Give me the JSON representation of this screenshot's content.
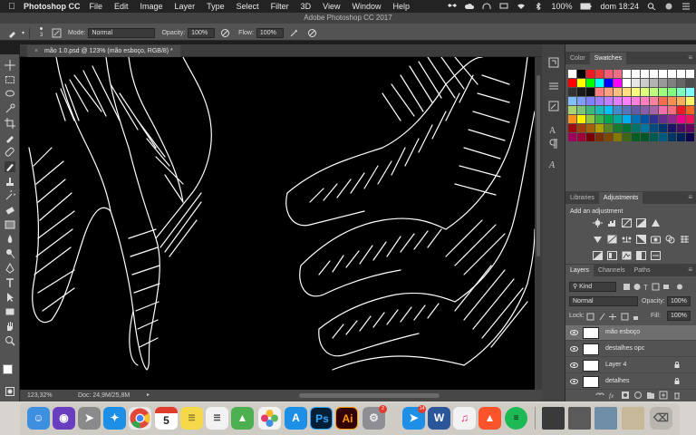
{
  "menubar": {
    "app_name": "Photoshop CC",
    "items": [
      "File",
      "Edit",
      "Image",
      "Layer",
      "Type",
      "Select",
      "Filter",
      "3D",
      "View",
      "Window",
      "Help"
    ],
    "battery": "100%",
    "clock": "dom 18:24"
  },
  "window": {
    "title": "Adobe Photoshop CC 2017"
  },
  "options": {
    "brush_size": "3",
    "mode_label": "Mode:",
    "mode_value": "Normal",
    "opacity_label": "Opacity:",
    "opacity_value": "100%",
    "flow_label": "Flow:",
    "flow_value": "100%"
  },
  "document": {
    "tab_label": "mão 1.0.psd @ 123% (mão esboço, RGB/8) *",
    "zoom": "123,32%",
    "doc_info": "Doc: 24,9M/25,8M"
  },
  "swatches_panel": {
    "tabs": [
      "Color",
      "Swatches"
    ],
    "active_tab": "Swatches",
    "colors": [
      "#ffffff",
      "#000000",
      "#ec1c24",
      "#ed3a3a",
      "#f45e7a",
      "#ed6e84",
      "#ffffff",
      "#ffffff",
      "#ffffff",
      "#ffffff",
      "#ffffff",
      "#ffffff",
      "#ffffff",
      "#ffffff",
      "#ff0000",
      "#ffff00",
      "#00ff00",
      "#00ffff",
      "#0000ff",
      "#ff00ff",
      "#ffffff",
      "#e6e6e6",
      "#cccccc",
      "#b3b3b3",
      "#999999",
      "#808080",
      "#666666",
      "#4d4d4d",
      "#333333",
      "#1a1a1a",
      "#0d0d0d",
      "#ff7f7f",
      "#ff9f7f",
      "#ffbf7f",
      "#ffdf7f",
      "#ffff7f",
      "#dfff7f",
      "#bfff7f",
      "#9fff7f",
      "#7fff7f",
      "#7fffbf",
      "#7fffff",
      "#7fbfff",
      "#7f9fff",
      "#7f7fff",
      "#9f7fff",
      "#bf7fff",
      "#df7fff",
      "#ff7fff",
      "#ff7fdf",
      "#ff7fbf",
      "#ff7f9f",
      "#f26c4f",
      "#f68e55",
      "#fbaf5c",
      "#fff467",
      "#acd372",
      "#7cc576",
      "#3bb878",
      "#1abbb4",
      "#00bff3",
      "#438cca",
      "#5574b9",
      "#605ca8",
      "#855fa8",
      "#a763a8",
      "#f06ea9",
      "#f26d7d",
      "#ed1c24",
      "#f26522",
      "#f7941d",
      "#fff200",
      "#8dc63f",
      "#39b54a",
      "#00a651",
      "#00a99d",
      "#00aeef",
      "#0072bc",
      "#0054a6",
      "#2e3192",
      "#662d91",
      "#92278f",
      "#ec008c",
      "#ed145b",
      "#9e0b0f",
      "#a0410d",
      "#a36209",
      "#aba000",
      "#598527",
      "#1a7b30",
      "#007236",
      "#00746b",
      "#0076a3",
      "#004b80",
      "#003471",
      "#1b1464",
      "#440e62",
      "#630460",
      "#9e005d",
      "#9e0039",
      "#790000",
      "#7b2e00",
      "#7d4900",
      "#827b00",
      "#406618",
      "#005e20",
      "#005826",
      "#005952",
      "#005b7f",
      "#003663",
      "#002157",
      "#0d004c"
    ]
  },
  "adjustments_panel": {
    "tabs": [
      "Libraries",
      "Adjustments"
    ],
    "active_tab": "Adjustments",
    "heading": "Add an adjustment"
  },
  "layers_panel": {
    "tabs": [
      "Layers",
      "Channels",
      "Paths"
    ],
    "active_tab": "Layers",
    "kind_filter": "Kind",
    "blend_mode": "Normal",
    "opacity_label": "Opacity:",
    "opacity_value": "100%",
    "lock_label": "Lock:",
    "fill_label": "Fill:",
    "fill_value": "100%",
    "layers": [
      {
        "name": "mão esboço",
        "selected": true,
        "locked": false
      },
      {
        "name": "destalhes opc",
        "selected": false,
        "locked": false
      },
      {
        "name": "Layer 4",
        "selected": false,
        "locked": true
      },
      {
        "name": "detalhes",
        "selected": false,
        "locked": true
      }
    ]
  },
  "dock": {
    "calendar_day": "5",
    "mail_badge": "14",
    "settings_badge": "2",
    "photoshop_label": "Ps",
    "illustrator_label": "Ai",
    "word_label": "W"
  },
  "colors": {
    "ps_panel": "#535353",
    "ps_dark": "#3c3c3c",
    "ps_blue": "#31a8ff",
    "ai_orange": "#ff9a00"
  }
}
